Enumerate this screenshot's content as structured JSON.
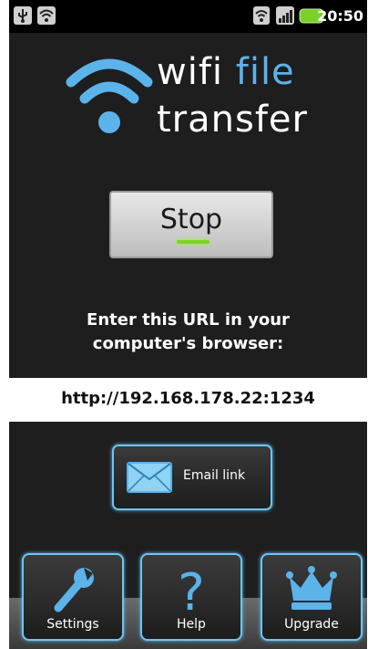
{
  "status_bar": {
    "time": "20:50",
    "left_icons": [
      "usb-icon",
      "wifi-icon"
    ],
    "right_icons": [
      "wifi-icon",
      "signal-icon",
      "battery-icon"
    ],
    "battery_color": "#7bd02b"
  },
  "app": {
    "logo_word_wifi": "wifi",
    "logo_word_file": "file",
    "logo_word_transfer": "transfer",
    "logo_accent": "#5bb3ea"
  },
  "stop_button": {
    "label": "Stop",
    "indicator_color": "#7cd321"
  },
  "instruction": {
    "line1": "Enter this URL in your",
    "line2": "computer's browser:"
  },
  "url": "http://192.168.178.22:1234",
  "email_button": {
    "label": "Email link",
    "icon": "envelope-icon"
  },
  "bottom_tabs": [
    {
      "label": "Settings",
      "icon": "wrench-icon"
    },
    {
      "label": "Help",
      "icon": "question-icon"
    },
    {
      "label": "Upgrade",
      "icon": "crown-icon"
    }
  ]
}
